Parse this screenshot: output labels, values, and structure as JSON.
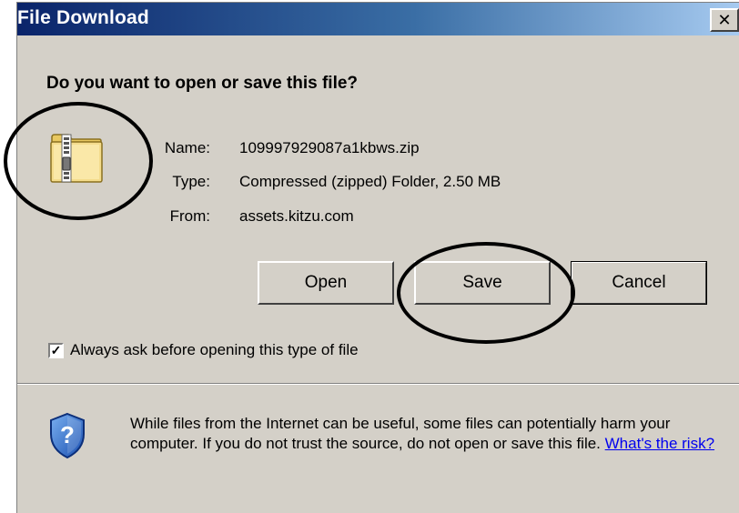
{
  "window": {
    "title": "File Download",
    "close_glyph": "✕"
  },
  "prompt": {
    "question": "Do you want to open or save this file?"
  },
  "file": {
    "icon": "zip-folder-icon",
    "name_label": "Name:",
    "name_value": "109997929087a1kbws.zip",
    "type_label": "Type:",
    "type_value": "Compressed (zipped) Folder, 2.50 MB",
    "from_label": "From:",
    "from_value": "assets.kitzu.com"
  },
  "buttons": {
    "open": "Open",
    "save": "Save",
    "cancel": "Cancel"
  },
  "options": {
    "always_ask_label": "Always ask before opening this type of file",
    "always_ask_checked": true,
    "check_glyph": "✓"
  },
  "warning": {
    "icon": "shield-question-icon",
    "text": "While files from the Internet can be useful, some files can potentially harm your computer. If you do not trust the source, do not open or save this file.",
    "link": "What's the risk?"
  },
  "annotations": {
    "color": "#000000",
    "circled": [
      "zip-folder-icon",
      "save-button"
    ]
  }
}
